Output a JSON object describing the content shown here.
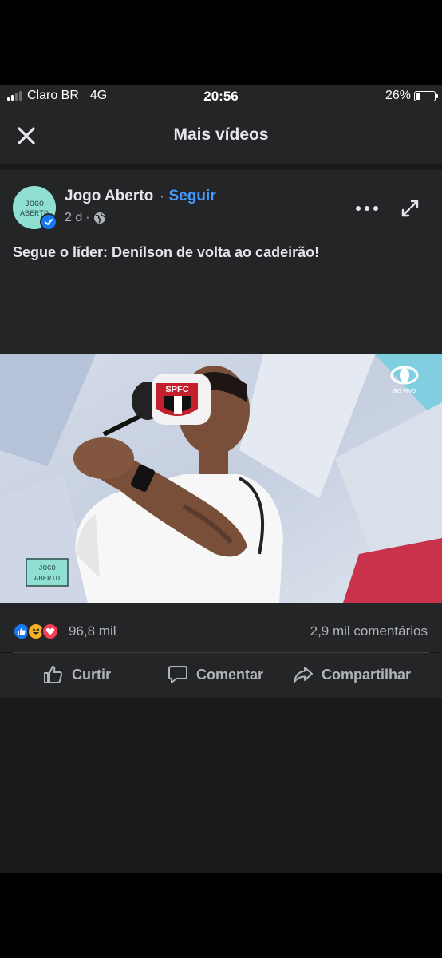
{
  "status_bar": {
    "carrier": "Claro BR",
    "network": "4G",
    "time": "20:56",
    "battery_text": "26%",
    "battery_level": 0.26,
    "signal_bars_active": 2,
    "signal_bars_total": 4
  },
  "header": {
    "title": "Mais vídeos",
    "close_icon": "close-icon"
  },
  "post": {
    "page_name": "Jogo Aberto",
    "separator": "·",
    "follow_label": "Seguir",
    "time_ago": "2 d",
    "meta_separator": "·",
    "privacy_icon": "globe-icon",
    "avatar_text_line1": "JOGO",
    "avatar_text_line2": "ABERTO",
    "caption": "Segue o líder: Denílson de volta ao cadeirão!",
    "video": {
      "badge_text": "ao vivo",
      "helmet_text": "SPFC",
      "watermark_line1": "JOGO",
      "watermark_line2": "ABERTO"
    }
  },
  "engagement": {
    "reactions_count": "96,8 mil",
    "comments_count": "2,9 mil comentários",
    "reaction_icons": [
      "like-icon",
      "haha-icon",
      "love-icon"
    ]
  },
  "actions": {
    "like_label": "Curtir",
    "comment_label": "Comentar",
    "share_label": "Compartilhar"
  },
  "colors": {
    "background": "#18191a",
    "card": "#242526",
    "accent": "#4599ff",
    "like_blue": "#1877f2",
    "love_red": "#f33e58",
    "haha_yellow": "#f7b125"
  }
}
